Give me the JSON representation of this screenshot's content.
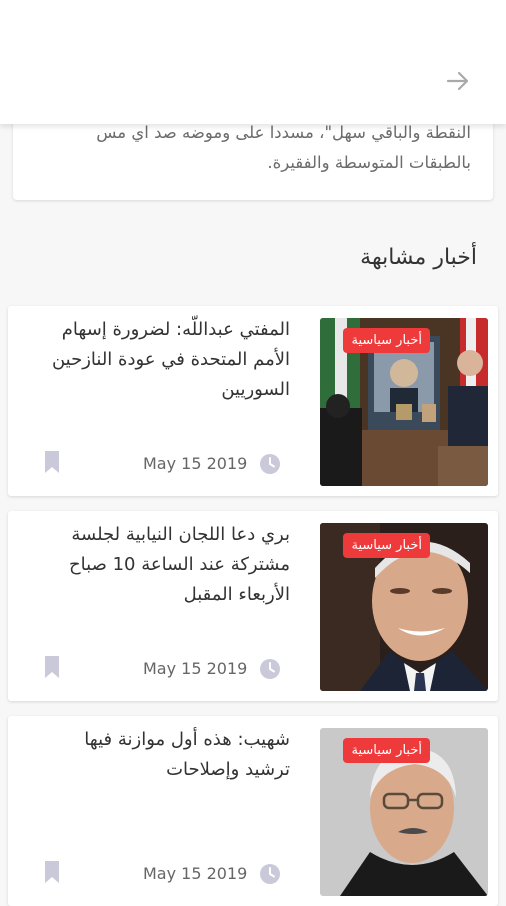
{
  "header": {
    "back_icon": "arrow-right-icon"
  },
  "article": {
    "text_tail": "النقطة والباقي سهل\"، مسددا على وموضه صد اي مس بالطبقات المتوسطة والفقيرة."
  },
  "related": {
    "title": "أخبار مشابهة",
    "items": [
      {
        "title": "المفتي عبداللّه: لضرورة إسهام الأمم المتحدة في عودة النازحين السوريين",
        "category": "أخبار سياسية",
        "date": "May 15 2019",
        "image": "meeting-photo"
      },
      {
        "title": "بري دعا اللجان النيابية لجلسة مشتركة عند الساعة 10 صباح الأربعاء المقبل",
        "category": "أخبار سياسية",
        "date": "May 15 2019",
        "image": "portrait-photo"
      },
      {
        "title": "شهيب: هذه أول موازنة فيها ترشيد وإصلاحات",
        "category": "أخبار سياسية",
        "date": "May 15 2019",
        "image": "portrait-photo"
      }
    ]
  },
  "colors": {
    "badge": "#ef3a3c",
    "icon": "#c9c9d9",
    "text": "#333333"
  }
}
